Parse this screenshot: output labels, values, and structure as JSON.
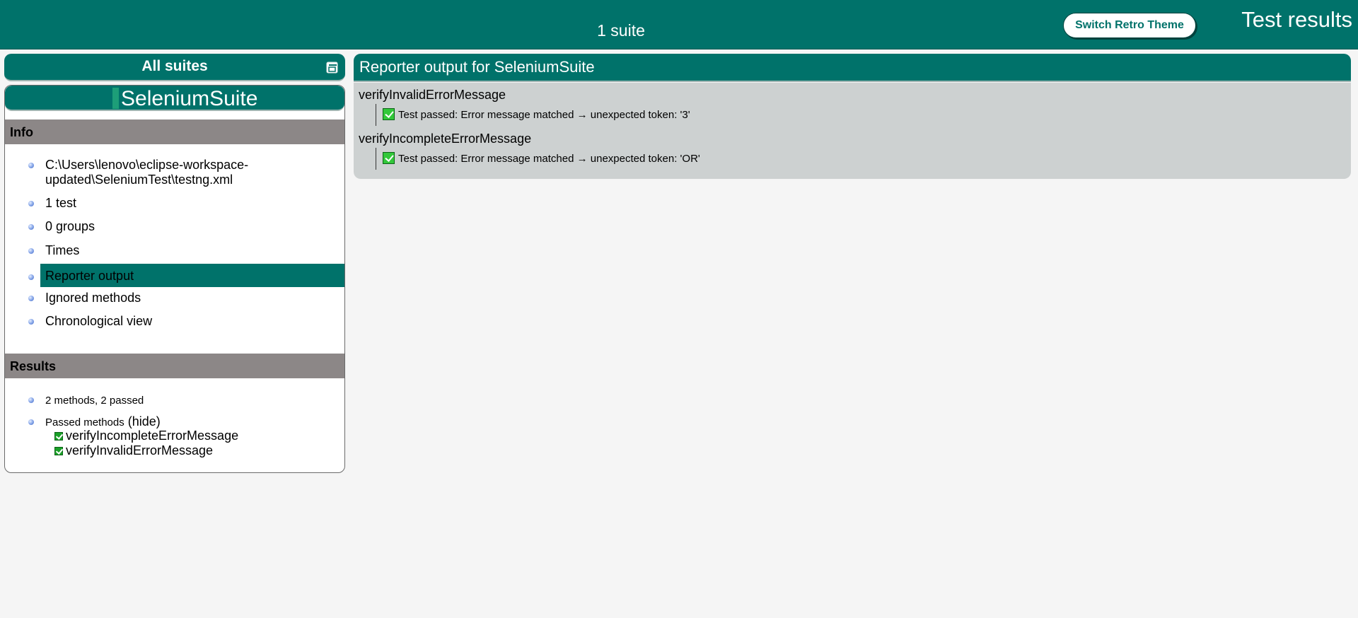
{
  "header": {
    "suite_count": "1 suite",
    "theme_button": "Switch Retro Theme",
    "title": "Test results"
  },
  "navigator": {
    "all_suites_label": "All suites",
    "suite_name": "SeleniumSuite",
    "info_section": {
      "title": "Info",
      "items": [
        {
          "line1": "C:\\Users\\lenovo\\eclipse-workspace-",
          "line2": "updated\\SeleniumTest\\testng.xml"
        },
        {
          "label": "1 test"
        },
        {
          "label": "0 groups"
        },
        {
          "label": "Times"
        },
        {
          "label": "Reporter output",
          "selected": true
        },
        {
          "label": "Ignored methods"
        },
        {
          "label": "Chronological view"
        }
      ]
    },
    "results_section": {
      "title": "Results",
      "summary": "2 methods, 2 passed",
      "passed_label": "Passed methods",
      "hide_link": "(hide)",
      "passed_methods": [
        "verifyIncompleteErrorMessage",
        "verifyInvalidErrorMessage"
      ]
    }
  },
  "reporter": {
    "title": "Reporter output for SeleniumSuite",
    "methods": [
      {
        "name": "verifyInvalidErrorMessage",
        "output": "Test passed: Error message matched → unexpected token: '3'"
      },
      {
        "name": "verifyIncompleteErrorMessage",
        "output": "Test passed: Error message matched → unexpected token: 'OR'"
      }
    ]
  },
  "colors": {
    "primary": "#00726a",
    "section_header": "#8c8787",
    "output_background": "#cdd1d1",
    "page_background": "#f5f5f5"
  }
}
